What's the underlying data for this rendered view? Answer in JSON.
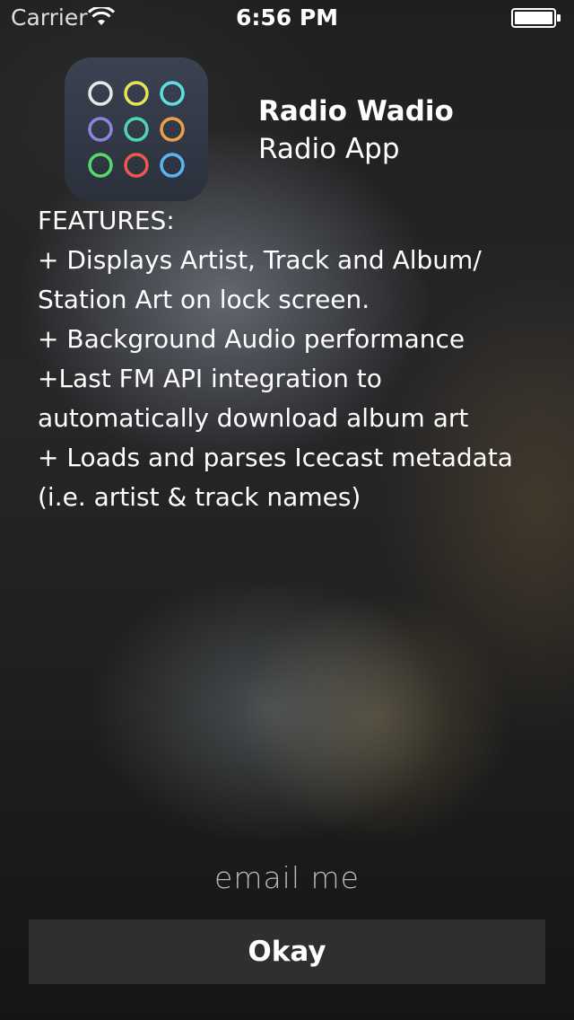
{
  "status_bar": {
    "carrier": "Carrier",
    "time": "6:56 PM",
    "wifi_icon": "wifi-icon",
    "battery_icon": "battery-icon"
  },
  "app": {
    "icon": "app-grid-circles-icon",
    "name": "Radio Wadio",
    "subtitle": "Radio App"
  },
  "features": {
    "lines": [
      "FEATURES:",
      "+ Displays Artist, Track and Album/",
      "Station Art on lock screen.",
      "+ Background Audio performance",
      "+Last FM API integration to",
      "automatically download album art",
      "+ Loads and parses Icecast metadata",
      "(i.e. artist & track names)"
    ]
  },
  "footer": {
    "email_label": "email me",
    "okay_label": "Okay"
  },
  "colors": {
    "circle_colors": [
      "#e8e8e8",
      "#e6e35a",
      "#5fe0e0",
      "#8a86e0",
      "#4fd6b0",
      "#e8a34a",
      "#58d86a",
      "#e85a4c",
      "#5ab6f0"
    ],
    "button_bg": "#2f2f31"
  }
}
